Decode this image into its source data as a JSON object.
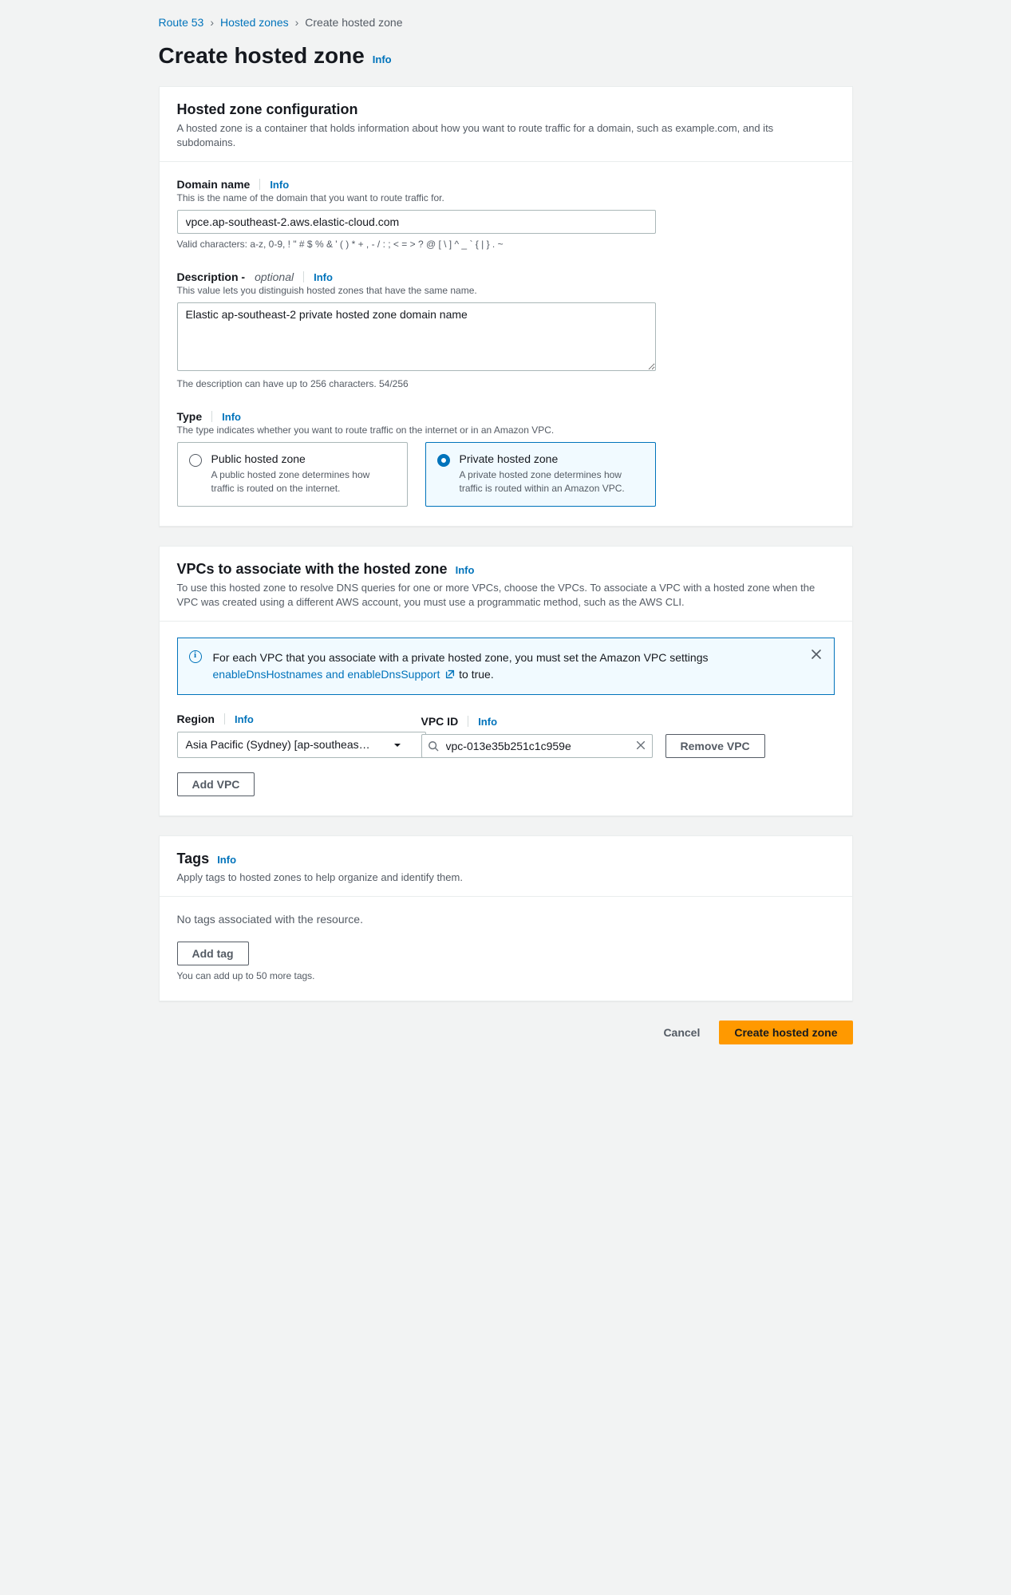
{
  "breadcrumb": {
    "route53": "Route 53",
    "hosted_zones": "Hosted zones",
    "create": "Create hosted zone"
  },
  "page": {
    "title": "Create hosted zone",
    "info": "Info"
  },
  "config": {
    "title": "Hosted zone configuration",
    "desc": "A hosted zone is a container that holds information about how you want to route traffic for a domain, such as example.com, and its subdomains.",
    "domain": {
      "label": "Domain name",
      "info": "Info",
      "hint": "This is the name of the domain that you want to route traffic for.",
      "value": "vpce.ap-southeast-2.aws.elastic-cloud.com",
      "below": "Valid characters: a-z, 0-9, ! \" # $ % & ' ( ) * + , - / : ; < = > ? @ [ \\ ] ^ _ ` { | } . ~"
    },
    "description": {
      "label": "Description -",
      "optional": "optional",
      "info": "Info",
      "hint": "This value lets you distinguish hosted zones that have the same name.",
      "value": "Elastic ap-southeast-2 private hosted zone domain name",
      "below": "The description can have up to 256 characters. 54/256"
    },
    "type": {
      "label": "Type",
      "info": "Info",
      "hint": "The type indicates whether you want to route traffic on the internet or in an Amazon VPC.",
      "public": {
        "title": "Public hosted zone",
        "desc": "A public hosted zone determines how traffic is routed on the internet."
      },
      "private": {
        "title": "Private hosted zone",
        "desc": "A private hosted zone determines how traffic is routed within an Amazon VPC."
      }
    }
  },
  "vpcs": {
    "title": "VPCs to associate with the hosted zone",
    "info": "Info",
    "desc": "To use this hosted zone to resolve DNS queries for one or more VPCs, choose the VPCs. To associate a VPC with a hosted zone when the VPC was created using a different AWS account, you must use a programmatic method, such as the AWS CLI.",
    "alert": {
      "text_before_link": "For each VPC that you associate with a private hosted zone, you must set the Amazon VPC settings ",
      "link": "enableDnsHostnames and enableDnsSupport",
      "text_after_link": " to true."
    },
    "region": {
      "label": "Region",
      "info": "Info",
      "value": "Asia Pacific (Sydney) [ap-southeas…"
    },
    "vpcid": {
      "label": "VPC ID",
      "info": "Info",
      "value": "vpc-013e35b251c1c959e"
    },
    "remove_btn": "Remove VPC",
    "add_btn": "Add VPC"
  },
  "tags": {
    "title": "Tags",
    "info": "Info",
    "desc": "Apply tags to hosted zones to help organize and identify them.",
    "empty": "No tags associated with the resource.",
    "add_btn": "Add tag",
    "below": "You can add up to 50 more tags."
  },
  "footer": {
    "cancel": "Cancel",
    "create": "Create hosted zone"
  }
}
